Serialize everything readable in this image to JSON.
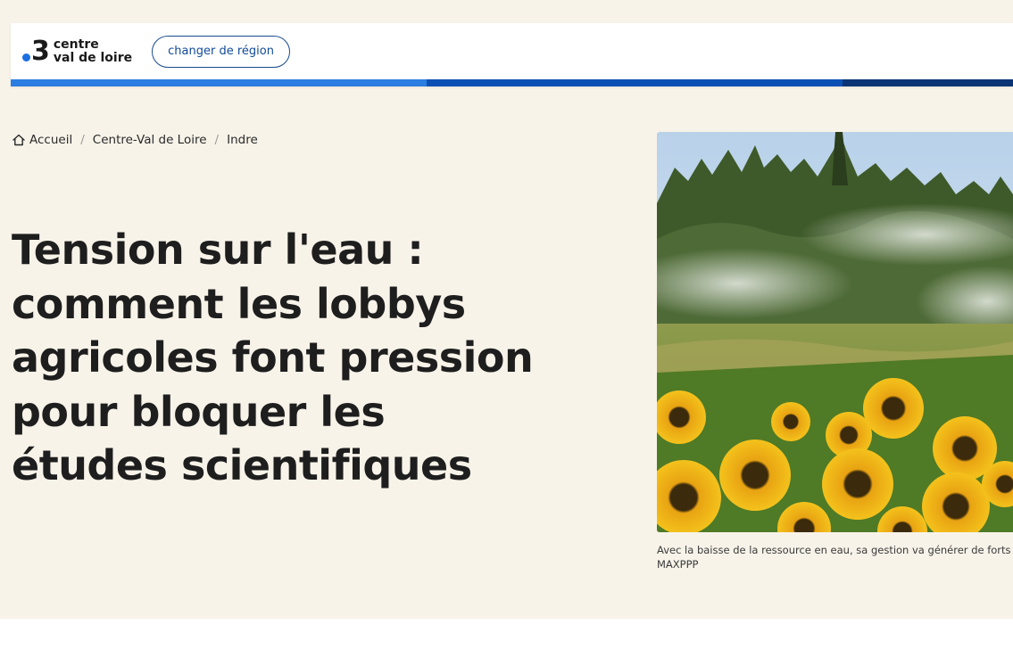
{
  "header": {
    "logo_number": "3",
    "logo_line1": "centre",
    "logo_line2": "val de loire",
    "region_button": "changer de région",
    "colors": {
      "stripe_light": "#2a7de1",
      "stripe_mid": "#0c4fb4",
      "stripe_dark": "#0b3474",
      "logo_dot": "#1b6ee3"
    }
  },
  "breadcrumb": {
    "home_icon": "home-icon",
    "items": [
      {
        "label": "Accueil"
      },
      {
        "label": "Centre-Val de Loire"
      },
      {
        "label": "Indre"
      }
    ],
    "separator": "/"
  },
  "article": {
    "title": "Tension sur l'eau : comment les lobbys agricoles font pression pour bloquer les études scientifiques",
    "image_caption": "Avec la baisse de la ressource en eau, sa gestion va générer de forts",
    "image_credit": "MAXPPP"
  }
}
